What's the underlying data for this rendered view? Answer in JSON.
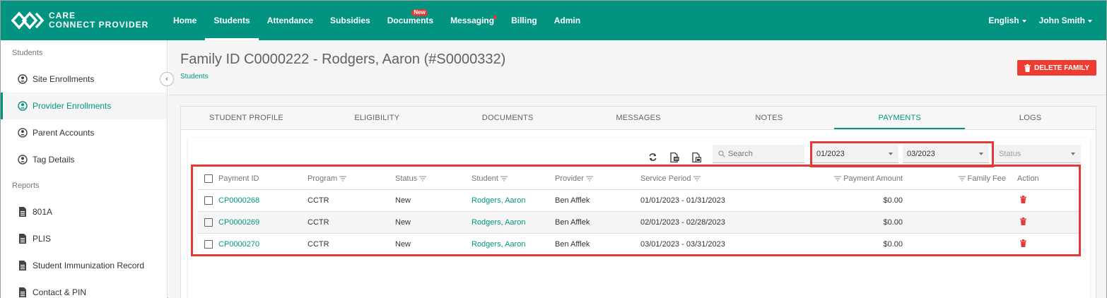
{
  "brand": {
    "line1": "CARE",
    "line2": "CONNECT PROVIDER"
  },
  "nav": {
    "items": [
      {
        "label": "Home"
      },
      {
        "label": "Students",
        "active": true
      },
      {
        "label": "Attendance"
      },
      {
        "label": "Subsidies"
      },
      {
        "label": "Documents",
        "badge": "New"
      },
      {
        "label": "Messaging",
        "dot": true
      },
      {
        "label": "Billing"
      },
      {
        "label": "Admin"
      }
    ],
    "language": "English",
    "user": "John Smith"
  },
  "sidebar": {
    "students_header": "Students",
    "students_items": [
      {
        "label": "Site Enrollments",
        "icon": "person-circle-icon"
      },
      {
        "label": "Provider Enrollments",
        "icon": "person-circle-icon",
        "active": true
      },
      {
        "label": "Parent Accounts",
        "icon": "person-circle-icon"
      },
      {
        "label": "Tag Details",
        "icon": "person-circle-icon"
      }
    ],
    "reports_header": "Reports",
    "reports_items": [
      {
        "label": "801A",
        "icon": "document-icon"
      },
      {
        "label": "PLIS",
        "icon": "document-icon"
      },
      {
        "label": "Student Immunization Record",
        "icon": "document-icon"
      },
      {
        "label": "Contact & PIN",
        "icon": "document-icon"
      }
    ]
  },
  "page": {
    "title": "Family ID C0000222 - Rodgers, Aaron (#S0000332)",
    "breadcrumb": "Students",
    "delete_label": "DELETE FAMILY"
  },
  "tabs": [
    "STUDENT PROFILE",
    "ELIGIBILITY",
    "DOCUMENTS",
    "MESSAGES",
    "NOTES",
    "PAYMENTS",
    "LOGS"
  ],
  "active_tab": "PAYMENTS",
  "filters": {
    "search_placeholder": "Search",
    "from": "01/2023",
    "to": "03/2023",
    "status_placeholder": "Status"
  },
  "table": {
    "columns": [
      "Payment ID",
      "Program",
      "Status",
      "Student",
      "Provider",
      "Service Period",
      "Payment Amount",
      "Family Fee",
      "Action"
    ],
    "rows": [
      {
        "id": "CP0000268",
        "program": "CCTR",
        "status": "New",
        "student": "Rodgers, Aaron",
        "provider": "Ben Afflek",
        "period": "01/01/2023 - 01/31/2023",
        "amount": "$0.00",
        "fee": ""
      },
      {
        "id": "CP0000269",
        "program": "CCTR",
        "status": "New",
        "student": "Rodgers, Aaron",
        "provider": "Ben Afflek",
        "period": "02/01/2023 - 02/28/2023",
        "amount": "$0.00",
        "fee": ""
      },
      {
        "id": "CP0000270",
        "program": "CCTR",
        "status": "New",
        "student": "Rodgers, Aaron",
        "provider": "Ben Afflek",
        "period": "03/01/2023 - 03/31/2023",
        "amount": "$0.00",
        "fee": ""
      }
    ]
  },
  "colors": {
    "brand": "#029481",
    "danger": "#ef3b32",
    "highlight": "#e53935"
  }
}
